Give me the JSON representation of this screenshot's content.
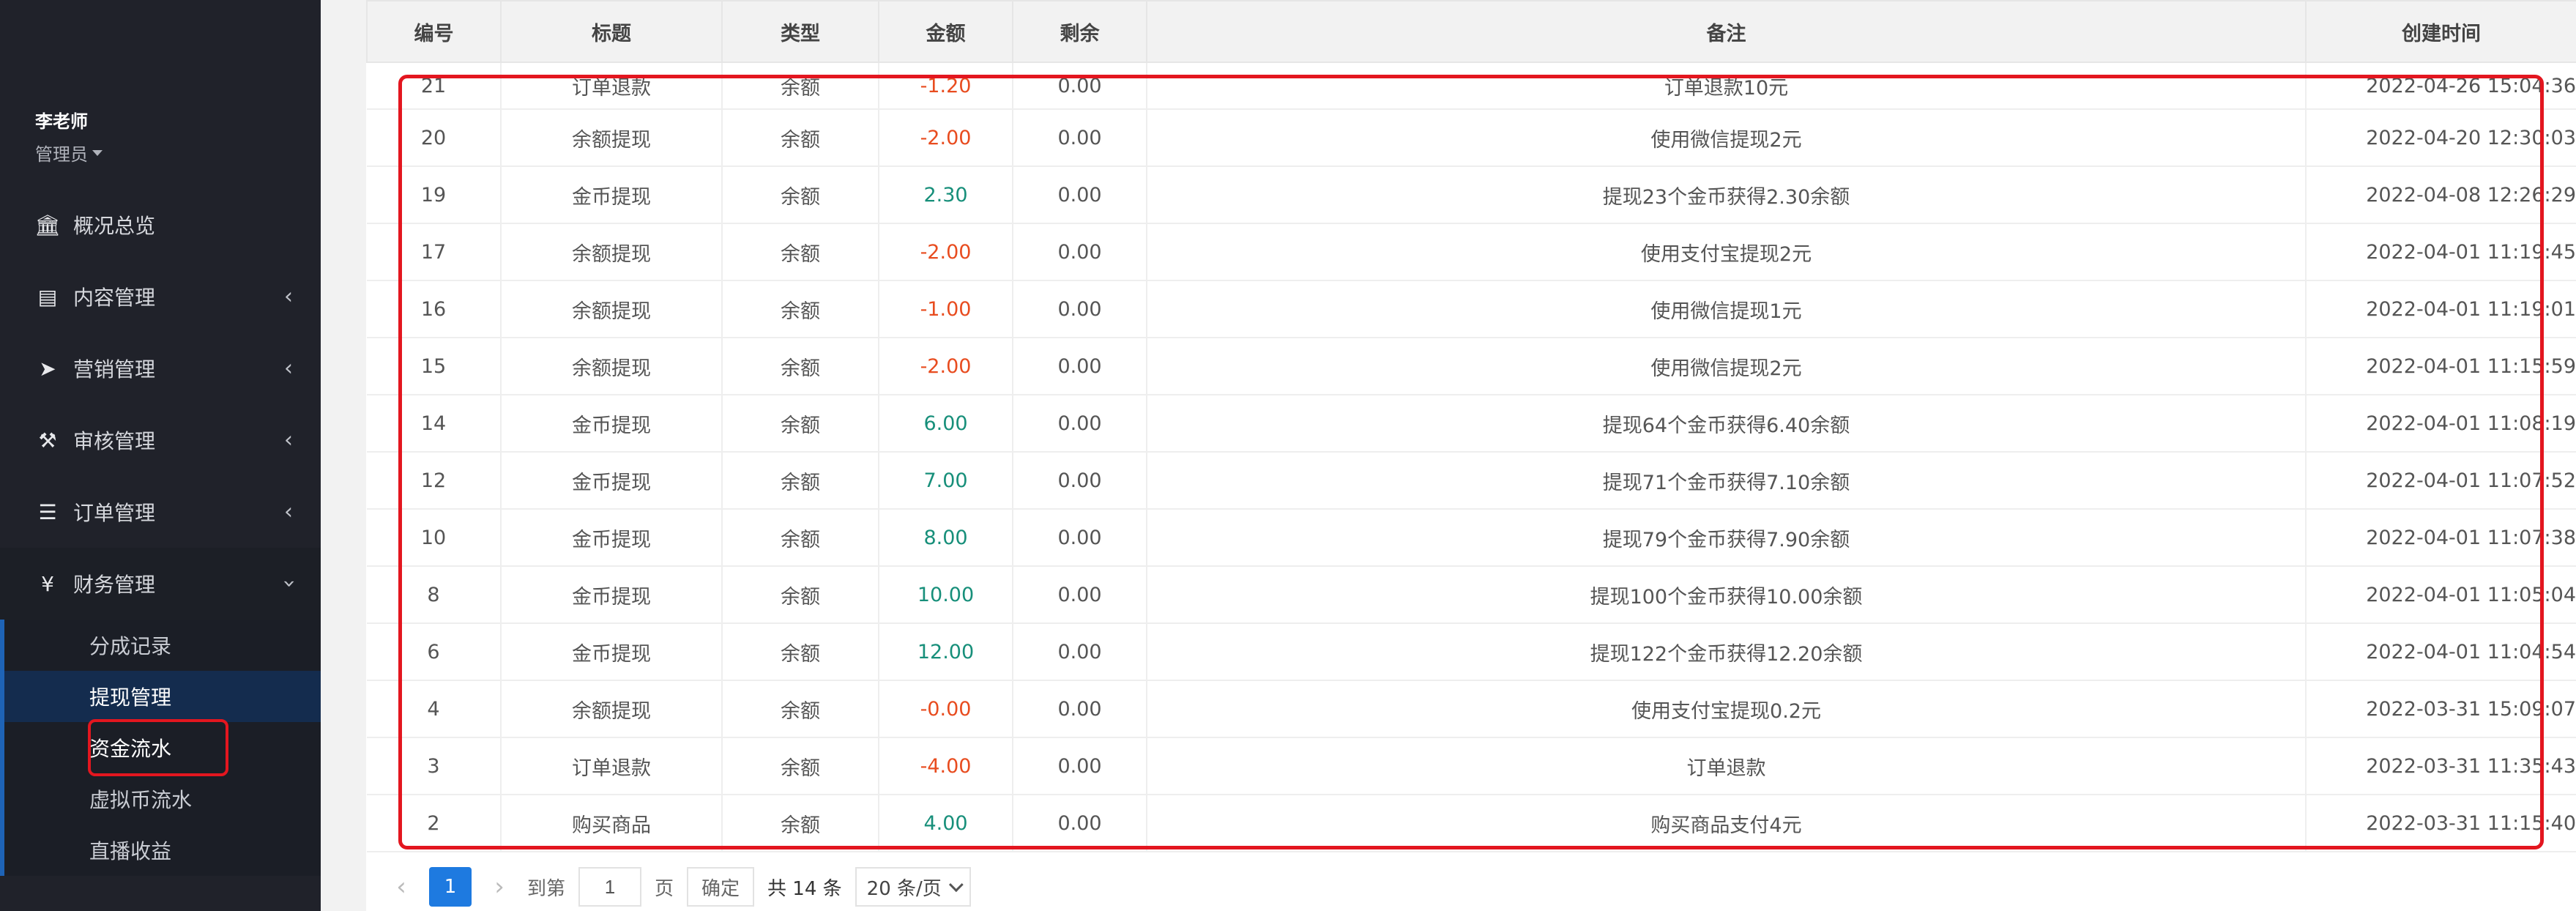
{
  "sidebar": {
    "user_name": "李老师",
    "user_role": "管理员",
    "nav": [
      {
        "label": "概况总览",
        "icon": "bank-icon",
        "glyph": "🏛"
      },
      {
        "label": "内容管理",
        "icon": "newspaper-icon",
        "glyph": "▤"
      },
      {
        "label": "营销管理",
        "icon": "paper-plane-icon",
        "glyph": "➤"
      },
      {
        "label": "审核管理",
        "icon": "gavel-icon",
        "glyph": "⚒"
      },
      {
        "label": "订单管理",
        "icon": "list-icon",
        "glyph": "☰"
      },
      {
        "label": "财务管理",
        "icon": "yen-icon",
        "glyph": "¥"
      }
    ],
    "finance_sub": [
      "分成记录",
      "提现管理",
      "资金流水",
      "虚拟币流水",
      "直播收益"
    ]
  },
  "table": {
    "headers": [
      "编号",
      "标题",
      "类型",
      "金额",
      "剩余",
      "备注",
      "创建时间"
    ],
    "rows": [
      {
        "id": "21",
        "title": "订单退款",
        "type": "余额",
        "amount": "-1.20",
        "rest": "0.00",
        "note": "订单退款10元",
        "time": "2022-04-26 15:04:36"
      },
      {
        "id": "20",
        "title": "余额提现",
        "type": "余额",
        "amount": "-2.00",
        "rest": "0.00",
        "note": "使用微信提现2元",
        "time": "2022-04-20 12:30:03"
      },
      {
        "id": "19",
        "title": "金币提现",
        "type": "余额",
        "amount": "2.30",
        "rest": "0.00",
        "note": "提现23个金币获得2.30余额",
        "time": "2022-04-08 12:26:29"
      },
      {
        "id": "17",
        "title": "余额提现",
        "type": "余额",
        "amount": "-2.00",
        "rest": "0.00",
        "note": "使用支付宝提现2元",
        "time": "2022-04-01 11:19:45"
      },
      {
        "id": "16",
        "title": "余额提现",
        "type": "余额",
        "amount": "-1.00",
        "rest": "0.00",
        "note": "使用微信提现1元",
        "time": "2022-04-01 11:19:01"
      },
      {
        "id": "15",
        "title": "余额提现",
        "type": "余额",
        "amount": "-2.00",
        "rest": "0.00",
        "note": "使用微信提现2元",
        "time": "2022-04-01 11:15:59"
      },
      {
        "id": "14",
        "title": "金币提现",
        "type": "余额",
        "amount": "6.00",
        "rest": "0.00",
        "note": "提现64个金币获得6.40余额",
        "time": "2022-04-01 11:08:19"
      },
      {
        "id": "12",
        "title": "金币提现",
        "type": "余额",
        "amount": "7.00",
        "rest": "0.00",
        "note": "提现71个金币获得7.10余额",
        "time": "2022-04-01 11:07:52"
      },
      {
        "id": "10",
        "title": "金币提现",
        "type": "余额",
        "amount": "8.00",
        "rest": "0.00",
        "note": "提现79个金币获得7.90余额",
        "time": "2022-04-01 11:07:38"
      },
      {
        "id": "8",
        "title": "金币提现",
        "type": "余额",
        "amount": "10.00",
        "rest": "0.00",
        "note": "提现100个金币获得10.00余额",
        "time": "2022-04-01 11:05:04"
      },
      {
        "id": "6",
        "title": "金币提现",
        "type": "余额",
        "amount": "12.00",
        "rest": "0.00",
        "note": "提现122个金币获得12.20余额",
        "time": "2022-04-01 11:04:54"
      },
      {
        "id": "4",
        "title": "余额提现",
        "type": "余额",
        "amount": "-0.00",
        "rest": "0.00",
        "note": "使用支付宝提现0.2元",
        "time": "2022-03-31 15:09:07"
      },
      {
        "id": "3",
        "title": "订单退款",
        "type": "余额",
        "amount": "-4.00",
        "rest": "0.00",
        "note": "订单退款",
        "time": "2022-03-31 11:35:43"
      },
      {
        "id": "2",
        "title": "购买商品",
        "type": "余额",
        "amount": "4.00",
        "rest": "0.00",
        "note": "购买商品支付4元",
        "time": "2022-03-31 11:15:40"
      }
    ]
  },
  "pager": {
    "current_page": "1",
    "goto_label": "到第",
    "goto_value": "1",
    "page_suffix": "页",
    "confirm_label": "确定",
    "total_label": "共 14 条",
    "page_size": "20 条/页"
  },
  "colors": {
    "negative": "#e84c1f",
    "positive": "#178f7a",
    "highlight": "#e3161f",
    "accent": "#1e7ae0"
  }
}
